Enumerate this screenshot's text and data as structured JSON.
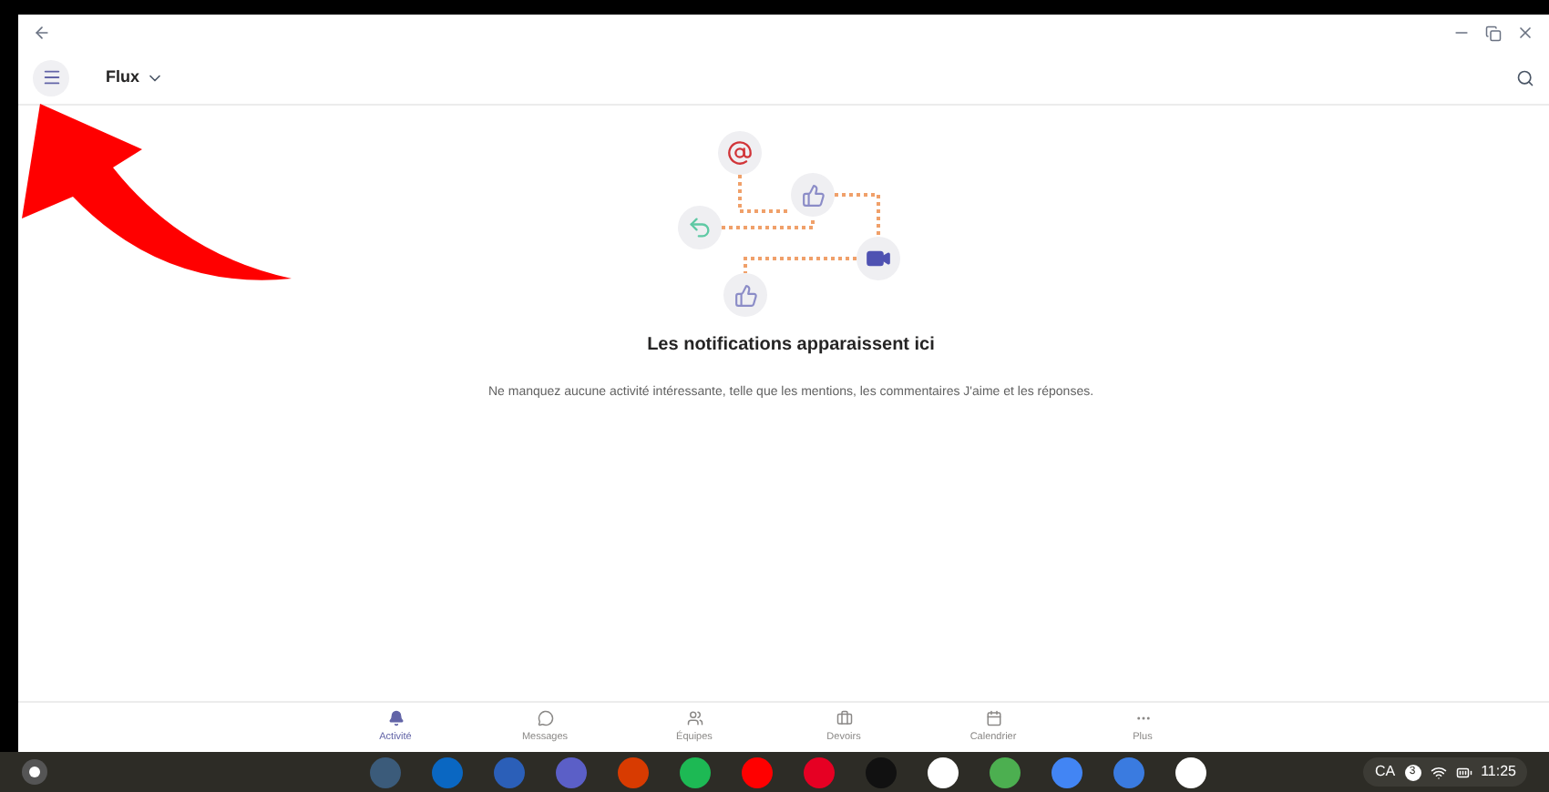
{
  "header": {
    "title": "Flux"
  },
  "empty_state": {
    "heading": "Les notifications apparaissent ici",
    "text": "Ne manquez aucune activité intéressante, telle que les mentions, les commentaires J'aime et les réponses."
  },
  "nav": [
    {
      "kind": "bell",
      "label": "Activité",
      "selected": true
    },
    {
      "kind": "chat",
      "label": "Messages",
      "selected": false
    },
    {
      "kind": "teams",
      "label": "Équipes",
      "selected": false
    },
    {
      "kind": "bag",
      "label": "Devoirs",
      "selected": false
    },
    {
      "kind": "calendar",
      "label": "Calendrier",
      "selected": false
    },
    {
      "kind": "more",
      "label": "Plus",
      "selected": false
    }
  ],
  "taskbar": {
    "apps": [
      {
        "color": "#3b5b7a"
      },
      {
        "color": "#0a67c2"
      },
      {
        "color": "#2b5fb8"
      },
      {
        "color": "#5b5fc7"
      },
      {
        "color": "#d83b01"
      },
      {
        "color": "#1db954"
      },
      {
        "color": "#ff0000"
      },
      {
        "color": "#e60023"
      },
      {
        "color": "#111111"
      },
      {
        "color": "#ffffff"
      },
      {
        "color": "#4caf50"
      },
      {
        "color": "#4285f4"
      },
      {
        "color": "#3a7be0"
      },
      {
        "color": "#ffffff"
      }
    ],
    "language": "CA",
    "notifications": "3",
    "time": "11:25"
  }
}
